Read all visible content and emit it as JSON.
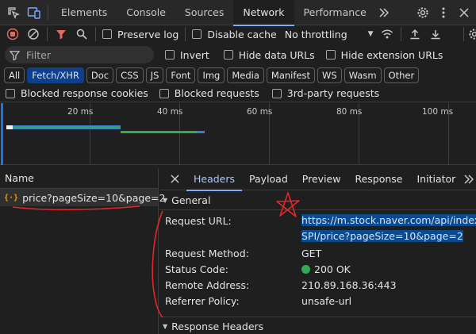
{
  "tabs": [
    "Elements",
    "Console",
    "Sources",
    "Network",
    "Performance"
  ],
  "toolbar": {
    "preserve_log": "Preserve log",
    "disable_cache": "Disable cache",
    "throttling": "No throttling"
  },
  "filter": {
    "placeholder": "Filter",
    "invert": "Invert",
    "hide_data_urls": "Hide data URLs",
    "hide_extension_urls": "Hide extension URLs"
  },
  "type_chips": [
    {
      "label": "All",
      "active": false
    },
    {
      "label": "Fetch/XHR",
      "active": true
    },
    {
      "label": "Doc",
      "active": false
    },
    {
      "label": "CSS",
      "active": false
    },
    {
      "label": "JS",
      "active": false
    },
    {
      "label": "Font",
      "active": false
    },
    {
      "label": "Img",
      "active": false
    },
    {
      "label": "Media",
      "active": false
    },
    {
      "label": "Manifest",
      "active": false
    },
    {
      "label": "WS",
      "active": false
    },
    {
      "label": "Wasm",
      "active": false
    },
    {
      "label": "Other",
      "active": false
    }
  ],
  "blocks": {
    "blocked_cookies": "Blocked response cookies",
    "blocked_requests": "Blocked requests",
    "third_party": "3rd-party requests"
  },
  "timeline": {
    "ticks": [
      "20 ms",
      "40 ms",
      "60 ms",
      "80 ms",
      "100 ms"
    ]
  },
  "requests": {
    "header": "Name",
    "items": [
      {
        "name": "price?pageSize=10&page=2"
      }
    ]
  },
  "details": {
    "tabs": [
      "Headers",
      "Payload",
      "Preview",
      "Response",
      "Initiator"
    ],
    "active_tab": "Headers",
    "general_title": "General",
    "response_headers_title": "Response Headers",
    "general": {
      "request_url_label": "Request URL:",
      "request_url_line1": "https://m.stock.naver.com/api/index/KO",
      "request_url_line2": "SPI/price?pageSize=10&page=2",
      "request_method_label": "Request Method:",
      "request_method": "GET",
      "status_code_label": "Status Code:",
      "status_code": "200 OK",
      "remote_address_label": "Remote Address:",
      "remote_address": "210.89.168.36:443",
      "referrer_policy_label": "Referrer Policy:",
      "referrer_policy": "unsafe-url"
    }
  },
  "colors": {
    "accent": "#7cacf8",
    "status_ok": "#34a853",
    "record_red": "#e46962",
    "annotation_red": "#e3262b",
    "selection": "#0b4a8e"
  }
}
